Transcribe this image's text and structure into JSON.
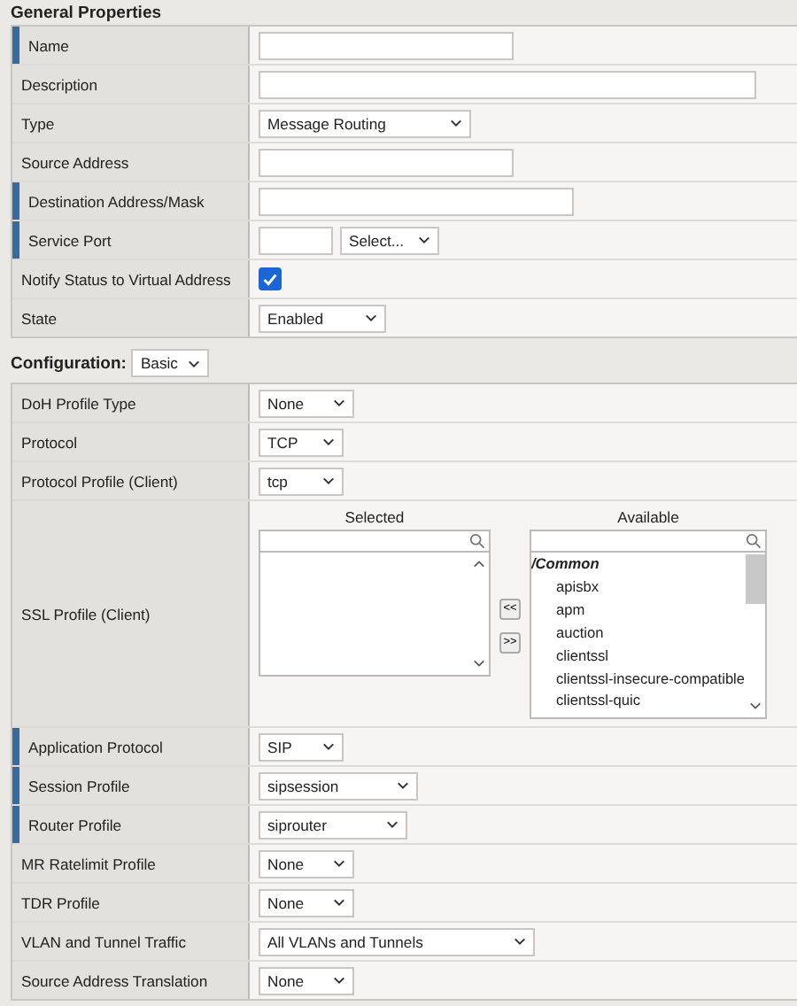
{
  "sections": [
    {
      "title": "General Properties",
      "rows": [
        {
          "label": "Name",
          "required": true,
          "kind": "text"
        },
        {
          "label": "Description",
          "required": false,
          "kind": "text"
        },
        {
          "label": "Type",
          "required": false,
          "kind": "select",
          "value": "Message Routing"
        },
        {
          "label": "Source Address",
          "required": false,
          "kind": "text"
        },
        {
          "label": "Destination Address/Mask",
          "required": true,
          "kind": "text"
        },
        {
          "label": "Service Port",
          "required": true,
          "kind": "port",
          "value": "Select..."
        },
        {
          "label": "Notify Status to Virtual Address",
          "required": false,
          "kind": "checkbox",
          "checked": true
        },
        {
          "label": "State",
          "required": false,
          "kind": "select",
          "value": "Enabled"
        }
      ]
    },
    {
      "title": "Configuration:",
      "mode": "Basic",
      "rows": [
        {
          "label": "DoH Profile Type",
          "required": false,
          "kind": "select",
          "value": "None"
        },
        {
          "label": "Protocol",
          "required": false,
          "kind": "select",
          "value": "TCP"
        },
        {
          "label": "Protocol Profile (Client)",
          "required": false,
          "kind": "select",
          "value": "tcp"
        },
        {
          "label": "SSL Profile (Client)",
          "required": false,
          "kind": "dual-list",
          "selected_title": "Selected",
          "available_title": "Available",
          "move_left": "<<",
          "move_right": ">>",
          "available": [
            {
              "label": "/Common",
              "kind": "folder"
            },
            {
              "label": "apisbx",
              "kind": "item"
            },
            {
              "label": "apm",
              "kind": "item"
            },
            {
              "label": "auction",
              "kind": "item"
            },
            {
              "label": "clientssl",
              "kind": "item"
            },
            {
              "label": "clientssl-insecure-compatible",
              "kind": "item"
            },
            {
              "label": "clientssl-quic",
              "kind": "item"
            }
          ]
        },
        {
          "label": "Application Protocol",
          "required": true,
          "kind": "select",
          "value": "SIP"
        },
        {
          "label": "Session Profile",
          "required": true,
          "kind": "select",
          "value": "sipsession"
        },
        {
          "label": "Router Profile",
          "required": true,
          "kind": "select",
          "value": "siprouter"
        },
        {
          "label": "MR Ratelimit Profile",
          "required": false,
          "kind": "select",
          "value": "None"
        },
        {
          "label": "TDR Profile",
          "required": false,
          "kind": "select",
          "value": "None"
        },
        {
          "label": "VLAN and Tunnel Traffic",
          "required": false,
          "kind": "select",
          "value": "All VLANs and Tunnels"
        },
        {
          "label": "Source Address Translation",
          "required": false,
          "kind": "select",
          "value": "None"
        }
      ]
    }
  ]
}
